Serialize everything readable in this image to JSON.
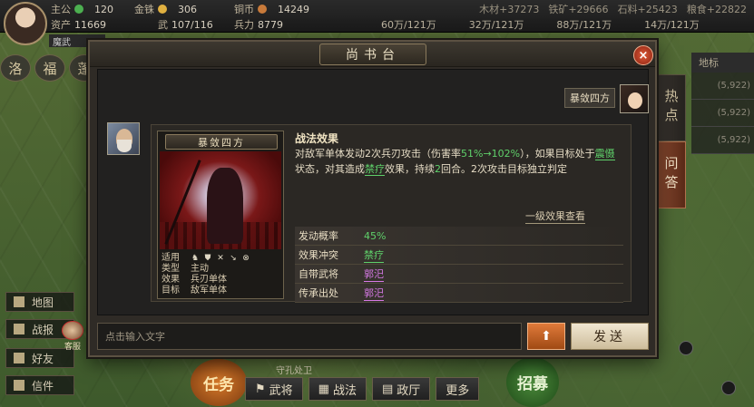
{
  "hud": {
    "resources": [
      {
        "label": "主公",
        "value": "120",
        "color": "#4caf50"
      },
      {
        "label": "金铢",
        "value": "306",
        "color": "#e0b040"
      },
      {
        "label": "铜币",
        "value": "14249",
        "color": "#c87a3a"
      }
    ],
    "row2": [
      {
        "label": "资产",
        "value": "11669"
      },
      {
        "label": "武",
        "value": "107/116"
      },
      {
        "label": "兵力",
        "value": "8779"
      }
    ],
    "right_top": [
      "木材+37273",
      "铁矿+29666",
      "石料+25423",
      "粮食+22822"
    ],
    "right_values": [
      "60万/121万",
      "32万/121万",
      "88万/121万",
      "14万/121万"
    ],
    "faction": "魔武",
    "left_tabs": [
      "洛",
      "福",
      "蓬"
    ]
  },
  "dialog": {
    "title": "尚书台",
    "close_label": "×",
    "my_tag": "暴敛四方",
    "card": {
      "name": "暴敛四方",
      "stats": [
        {
          "label": "适用",
          "value": ""
        },
        {
          "label": "类型",
          "value": "主动"
        },
        {
          "label": "效果",
          "value": "兵刃单体"
        },
        {
          "label": "目标",
          "value": "敌军单体"
        }
      ],
      "effect_title": "战法效果",
      "effect_desc_parts": {
        "p1": "对敌军单体发动2次兵刃攻击（伤害率",
        "p2": "51%→102%",
        "p3": "），如果目标处于",
        "p4": "震慑",
        "p5": "状态，对其造成",
        "p6": "禁疗",
        "p7": "效果，持续",
        "p8": "2",
        "p9": "回合。2次攻击目标独立判定"
      },
      "level_link": "一级效果查看",
      "attributes": [
        {
          "key": "发动概率",
          "value": "45%"
        },
        {
          "key": "效果冲突",
          "value": "禁疗"
        },
        {
          "key": "自带武将",
          "value": "郭汜"
        },
        {
          "key": "传承出处",
          "value": "郭汜"
        }
      ]
    },
    "input_placeholder": "点击输入文字",
    "send_label": "发送"
  },
  "side_tabs": {
    "hot": "热点",
    "qa": "问答"
  },
  "bg_list": {
    "header": "地标",
    "rows": [
      "(5,922)",
      "(5,922)",
      "(5,922)"
    ]
  },
  "side_buttons": [
    "地图",
    "战报",
    "好友",
    "信件"
  ],
  "customer_service": "客服",
  "bottom_buttons": [
    "武将",
    "战法",
    "政厅",
    "更多"
  ],
  "task_label": "任务",
  "recruit_label": "招募",
  "bottom_hint": "守孔处卫"
}
